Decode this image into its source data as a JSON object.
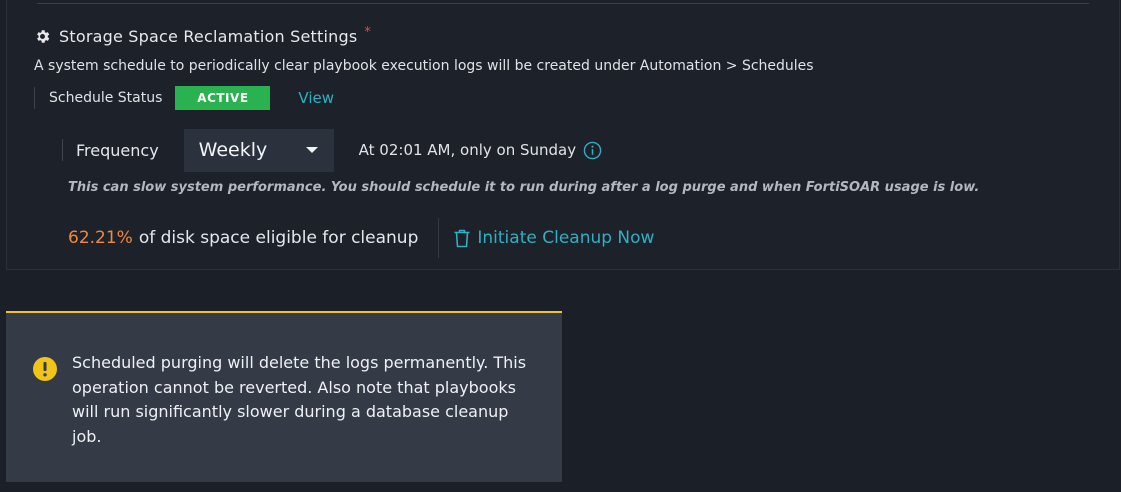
{
  "settings": {
    "title": "Storage Space Reclamation Settings",
    "required_mark": "*",
    "description": "A system schedule to periodically clear playbook execution logs will be created under Automation > Schedules"
  },
  "status": {
    "label": "Schedule Status",
    "badge": "ACTIVE",
    "view_link": "View"
  },
  "frequency": {
    "label": "Frequency",
    "selected": "Weekly",
    "schedule_text": "At 02:01 AM, only on Sunday"
  },
  "performance_note": "This can slow system performance. You should schedule it to run during after a log purge and when FortiSOAR usage is low.",
  "cleanup": {
    "percent": "62.21%",
    "eligible_text": "of disk space eligible for cleanup",
    "button_label": "Initiate Cleanup Now"
  },
  "alert": {
    "text": "Scheduled purging will delete the logs permanently. This operation cannot be reverted. Also note that playbooks will run significantly slower during a database cleanup job."
  },
  "icons": {
    "settings": "gear-icon",
    "info": "info-icon",
    "trash": "trash-icon",
    "warning": "exclamation-icon"
  },
  "colors": {
    "accent": "#2eb0c0",
    "active": "#2bb250",
    "percent": "#f0883e",
    "warning": "#f0c419",
    "required": "#e0484f"
  }
}
